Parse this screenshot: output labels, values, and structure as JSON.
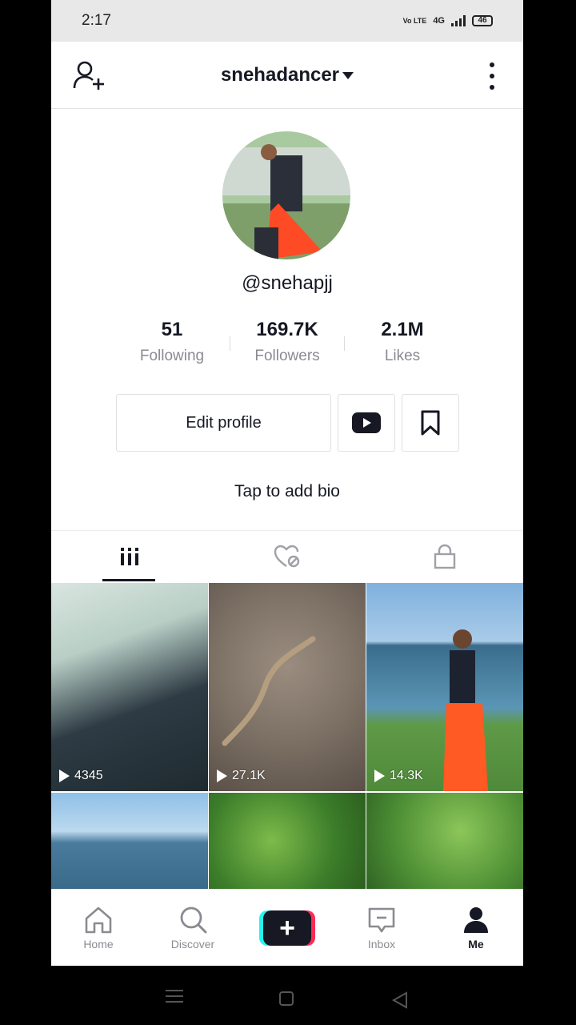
{
  "status_bar": {
    "time": "2:17",
    "network": "4G",
    "volte": "Vo LTE",
    "battery": "46"
  },
  "header": {
    "username": "snehadancer",
    "add_user_icon": "add-user-icon",
    "more_icon": "more-vertical-icon"
  },
  "profile": {
    "handle": "@snehapjj",
    "stats": [
      {
        "value": "51",
        "label": "Following"
      },
      {
        "value": "169.7K",
        "label": "Followers"
      },
      {
        "value": "2.1M",
        "label": "Likes"
      }
    ],
    "edit_profile_label": "Edit profile",
    "bio_prompt": "Tap to add bio"
  },
  "tabs": [
    {
      "icon": "videos-grid-icon",
      "active": true
    },
    {
      "icon": "liked-videos-icon",
      "active": false
    },
    {
      "icon": "lock-icon",
      "active": false
    }
  ],
  "videos": [
    {
      "views": "4345"
    },
    {
      "views": "27.1K"
    },
    {
      "views": "14.3K"
    },
    {
      "views": ""
    },
    {
      "views": ""
    },
    {
      "views": ""
    }
  ],
  "bottom_nav": [
    {
      "label": "Home",
      "icon": "home-icon"
    },
    {
      "label": "Discover",
      "icon": "search-icon"
    },
    {
      "label": "",
      "icon": "create-icon"
    },
    {
      "label": "Inbox",
      "icon": "inbox-icon"
    },
    {
      "label": "Me",
      "icon": "profile-icon",
      "active": true
    }
  ],
  "colors": {
    "text": "#161823",
    "muted": "#8a8b91",
    "cyan": "#25f4ee",
    "pink": "#fe2c55"
  }
}
